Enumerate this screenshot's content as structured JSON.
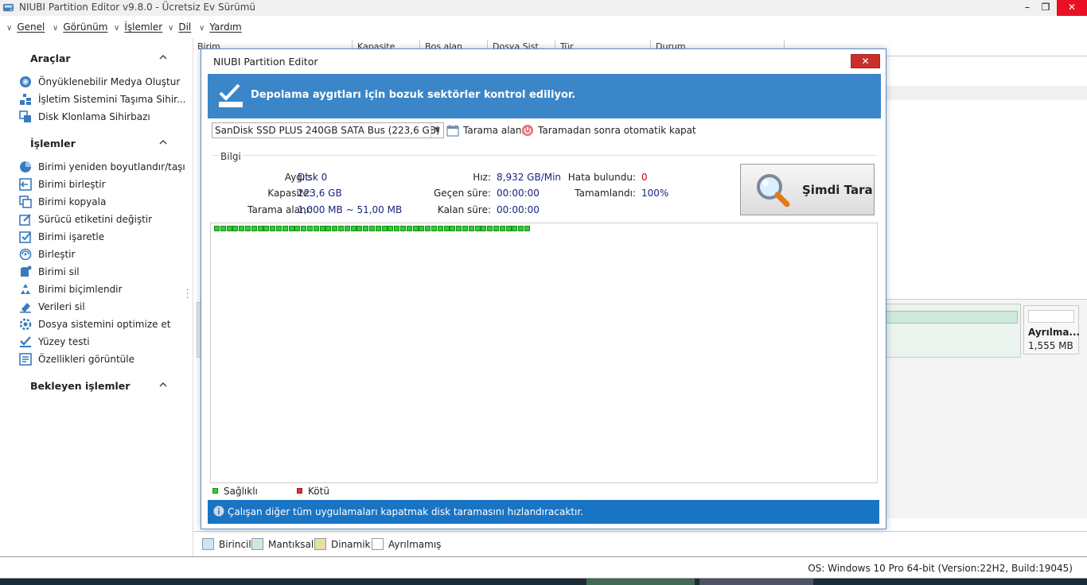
{
  "window": {
    "title": "NIUBI Partition Editor v9.8.0 - Ücretsiz Ev Sürümü",
    "min": "–",
    "restore": "❐",
    "close": "✕"
  },
  "menu": [
    {
      "label": "Genel"
    },
    {
      "label": "Görünüm"
    },
    {
      "label": "İşlemler"
    },
    {
      "label": "Dil"
    },
    {
      "label": "Yardım"
    }
  ],
  "sidebar": {
    "tools_title": "Araçlar",
    "tools": [
      {
        "label": "Önyüklenebilir Medya Oluştur",
        "icon": "boot-media-icon"
      },
      {
        "label": "İşletim Sistemini Taşıma Sihir...",
        "icon": "os-migrate-icon"
      },
      {
        "label": "Disk Klonlama Sihirbazı",
        "icon": "disk-clone-icon"
      }
    ],
    "ops_title": "İşlemler",
    "ops": [
      {
        "label": "Birimi yeniden boyutlandır/taşı",
        "icon": "resize-icon"
      },
      {
        "label": "Birimi birleştir",
        "icon": "merge-volume-icon"
      },
      {
        "label": "Birimi kopyala",
        "icon": "copy-volume-icon"
      },
      {
        "label": "Sürücü etiketini değiştir",
        "icon": "edit-label-icon"
      },
      {
        "label": "Birimi işaretle",
        "icon": "mark-volume-icon"
      },
      {
        "label": "Birleştir",
        "icon": "defrag-icon"
      },
      {
        "label": "Birimi sil",
        "icon": "delete-volume-icon"
      },
      {
        "label": "Birimi biçimlendir",
        "icon": "format-icon"
      },
      {
        "label": "Verileri sil",
        "icon": "wipe-data-icon"
      },
      {
        "label": "Dosya sistemini optimize et",
        "icon": "optimize-icon"
      },
      {
        "label": "Yüzey testi",
        "icon": "surface-test-icon"
      },
      {
        "label": "Özellikleri görüntüle",
        "icon": "properties-icon"
      }
    ],
    "pending_title": "Bekleyen işlemler"
  },
  "grid_headers": [
    "Birim",
    "Kapasite",
    "Boş alan",
    "Dosya Sist...",
    "Tür",
    "Durum"
  ],
  "disk_map": {
    "unallocated_name": "Ayrılma...",
    "unallocated_size": "1,555 MB"
  },
  "legend": [
    {
      "label": "Birincil",
      "color": "#cde3f7"
    },
    {
      "label": "Mantıksal",
      "color": "#cfe8dc"
    },
    {
      "label": "Dinamik",
      "color": "#e6e0a0"
    },
    {
      "label": "Ayrılmamış",
      "color": "#ffffff"
    }
  ],
  "status": {
    "os": "OS: Windows 10 Pro 64-bit (Version:22H2, Build:19045)"
  },
  "dialog": {
    "title": "NIUBI Partition Editor",
    "close": "✕",
    "banner": "Depolama aygıtları için bozuk sektörler kontrol ediliyor.",
    "device": "SanDisk SSD PLUS 240GB SATA Bus (223,6 GB)",
    "scan_range_label": "Tarama alanı",
    "auto_close_label": "Taramadan sonra otomatik kapat",
    "info_title": "Bilgi",
    "info": {
      "device_k": "Aygıt:",
      "device_v": "Disk 0",
      "capacity_k": "Kapasite:",
      "capacity_v": "223,6 GB",
      "range_k": "Tarama alanı:",
      "range_v": "1,000 MB ~ 51,00 MB",
      "speed_k": "Hız:",
      "speed_v": "8,932 GB/Min",
      "elapsed_k": "Geçen süre:",
      "elapsed_v": "00:00:00",
      "remaining_k": "Kalan süre:",
      "remaining_v": "00:00:00",
      "errors_k": "Hata bulundu:",
      "errors_v": "0",
      "done_k": "Tamamlandı:",
      "done_v": "100%"
    },
    "scan_button": "Şimdi Tara",
    "scanned_blocks": 51,
    "legend_good": "Sağlıklı",
    "legend_bad": "Kötü",
    "good_color": "#33cc33",
    "bad_color": "#e03030",
    "footer": "Çalışan diğer tüm uygulamaları kapatmak disk taramasını hızlandıracaktır."
  }
}
